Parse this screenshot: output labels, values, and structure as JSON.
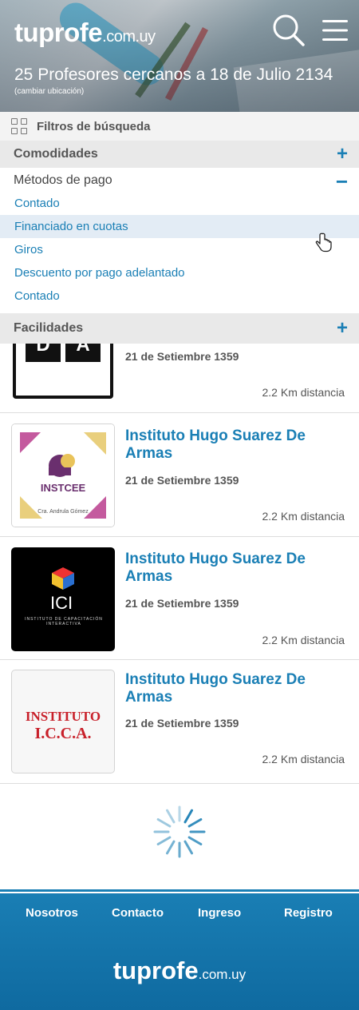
{
  "brand": {
    "name": "tuprofe",
    "domain": ".com.uy"
  },
  "header": {
    "title": "25 Profesores cercanos a 18 de Julio 2134",
    "change_location": "(cambiar ubicación)",
    "search_icon": "search-icon",
    "menu_icon": "hamburger-menu-icon"
  },
  "filters": {
    "label": "Filtros de búsqueda",
    "sections": {
      "comodidades": {
        "label": "Comodidades",
        "toggle": "+"
      },
      "metodos_pago": {
        "label": "Métodos de pago",
        "toggle": "−",
        "options": [
          "Contado",
          "Financiado en cuotas",
          "Giros",
          "Descuento por pago adelantado",
          "Contado"
        ],
        "highlighted_index": 1
      },
      "facilidades": {
        "label": "Facilidades",
        "toggle": "+"
      }
    }
  },
  "listings": [
    {
      "logo_text": "D A",
      "name": "",
      "address": "21 de Setiembre 1359",
      "distance": "2.2 Km distancia"
    },
    {
      "logo_text": "INSTCEE",
      "logo_caption": "Cra. Andrula Gómez",
      "name": "Instituto Hugo Suarez De Armas",
      "address": "21 de Setiembre 1359",
      "distance": "2.2 Km distancia"
    },
    {
      "logo_text": "ICI",
      "logo_caption": "INSTITUTO DE CAPACITACIÓN INTERACTIVA",
      "name": "Instituto Hugo Suarez De Armas",
      "address": "21 de Setiembre 1359",
      "distance": "2.2 Km distancia"
    },
    {
      "logo_text_line1": "INSTITUTO",
      "logo_text_line2": "I.C.C.A.",
      "name": "Instituto Hugo Suarez De Armas",
      "address": "21 de Setiembre 1359",
      "distance": "2.2 Km distancia"
    }
  ],
  "footer": {
    "nav": [
      "Nosotros",
      "Contacto",
      "Ingreso",
      "Registro"
    ]
  },
  "colors": {
    "accent": "#1a7fb5",
    "highlight_row": "#e3ecf5",
    "section_bg": "#e9e9e9"
  }
}
